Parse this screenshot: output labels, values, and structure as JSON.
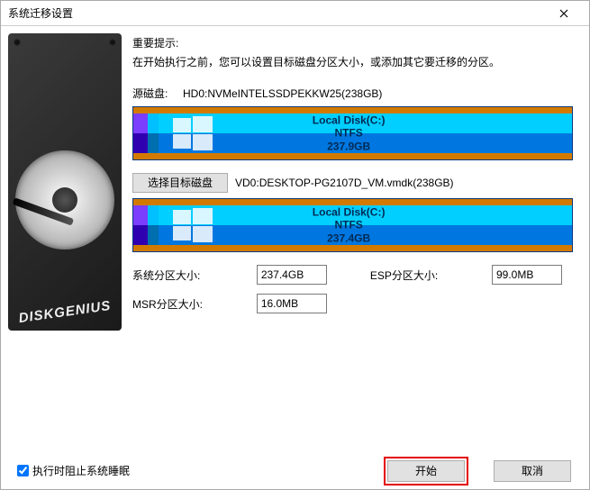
{
  "window": {
    "title": "系统迁移设置"
  },
  "sidebar": {
    "brand": "DISKGENIUS"
  },
  "tip": {
    "heading": "重要提示:",
    "text": "在开始执行之前，您可以设置目标磁盘分区大小，或添加其它要迁移的分区。"
  },
  "source": {
    "label": "源磁盘:",
    "name": "HD0:NVMeINTELSSDPEKKW25(238GB)"
  },
  "target": {
    "button": "选择目标磁盘",
    "name": "VD0:DESKTOP-PG2107D_VM.vmdk(238GB)"
  },
  "partitions": {
    "source": {
      "name": "Local Disk(C:)",
      "fs": "NTFS",
      "size": "237.9GB"
    },
    "target": {
      "name": "Local Disk(C:)",
      "fs": "NTFS",
      "size": "237.4GB"
    }
  },
  "sizes": {
    "system_label": "系统分区大小:",
    "system_value": "237.4GB",
    "esp_label": "ESP分区大小:",
    "esp_value": "99.0MB",
    "msr_label": "MSR分区大小:",
    "msr_value": "16.0MB"
  },
  "footer": {
    "sleep_label": "执行时阻止系统睡眠",
    "start": "开始",
    "cancel": "取消"
  }
}
